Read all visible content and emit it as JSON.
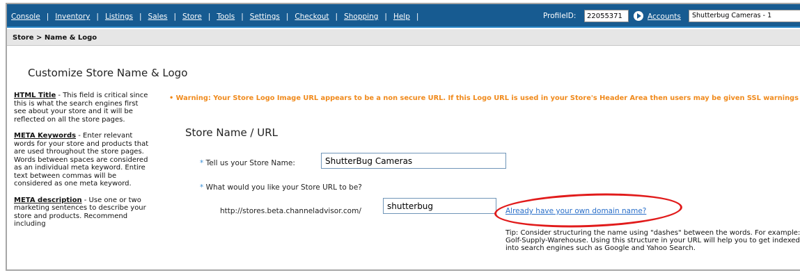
{
  "nav": {
    "items": [
      "Console",
      "Inventory",
      "Listings",
      "Sales",
      "Store",
      "Tools",
      "Settings",
      "Checkout",
      "Shopping",
      "Help"
    ],
    "profile_label": "ProfileID:",
    "profile_id": "22055371",
    "accounts_label": "Accounts",
    "account_selected": "Shutterbug Cameras - 1"
  },
  "breadcrumb": "Store > Name & Logo",
  "page": {
    "title": "Customize Store Name & Logo",
    "warning": "• Warning: Your Store Logo Image URL appears to be a non secure URL. If this Logo URL is used in your Store's Header Area then users may be given SSL warnings"
  },
  "help": [
    {
      "term": "HTML Title",
      "text": " - This field is critical since this is what the search engines first see about your store and it will be reflected on all the store pages."
    },
    {
      "term": "META Keywords",
      "text": " - Enter relevant words for your store and products that are used throughout the store pages. Words between spaces are considered as an individual meta keyword. Entire text between commas will be considered as one meta keyword."
    },
    {
      "term": "META description",
      "text": " - Use one or two marketing sentences to describe your store and products. Recommend including"
    }
  ],
  "section": {
    "title": "Store Name / URL",
    "star": "*",
    "store_name_label": " Tell us your Store Name:",
    "store_name_value": "ShutterBug Cameras",
    "url_question": " What would you like your Store URL to be?",
    "url_prefix": "http://stores.beta.channeladvisor.com/",
    "url_value": "shutterbug",
    "domain_link": "Already have your own domain name?",
    "tip": "Tip: Consider structuring the name using \"dashes\" between the words. For example: Golf-Supply-Warehouse. Using this structure in your URL will help you to get indexed into search engines such as Google and Yahoo Search."
  },
  "colors": {
    "nav_bg": "#175b91",
    "warning": "#f08a1c",
    "link": "#2a6fc9",
    "highlight": "#e11b1b",
    "required_star": "#3a8fd6"
  }
}
